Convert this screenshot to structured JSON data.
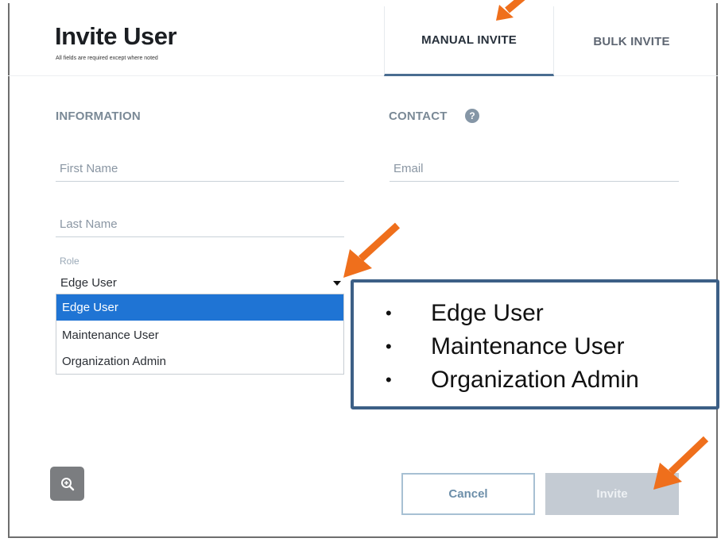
{
  "header": {
    "title": "Invite User",
    "subtitle": "All fields are required except where noted"
  },
  "tabs": [
    {
      "label": "MANUAL INVITE",
      "active": true
    },
    {
      "label": "BULK INVITE",
      "active": false
    }
  ],
  "information": {
    "label": "INFORMATION",
    "first_name": {
      "placeholder": "First Name",
      "value": ""
    },
    "last_name": {
      "placeholder": "Last Name",
      "value": ""
    },
    "role": {
      "label": "Role",
      "selected": "Edge User",
      "options": [
        "Edge User",
        "Maintenance User",
        "Organization Admin"
      ]
    }
  },
  "contact": {
    "label": "CONTACT",
    "help_icon": "question-circle-icon",
    "email": {
      "placeholder": "Email",
      "value": ""
    }
  },
  "callout": {
    "items": [
      "Edge User",
      "Maintenance User",
      "Organization Admin"
    ]
  },
  "footer": {
    "zoom_icon": "zoom-in-icon",
    "cancel_label": "Cancel",
    "invite_label": "Invite"
  },
  "colors": {
    "accent": "#1f74d4",
    "callout_border": "#3c5f86",
    "arrow": "#ef6f1c",
    "invite_disabled": "#c4cbd3"
  }
}
